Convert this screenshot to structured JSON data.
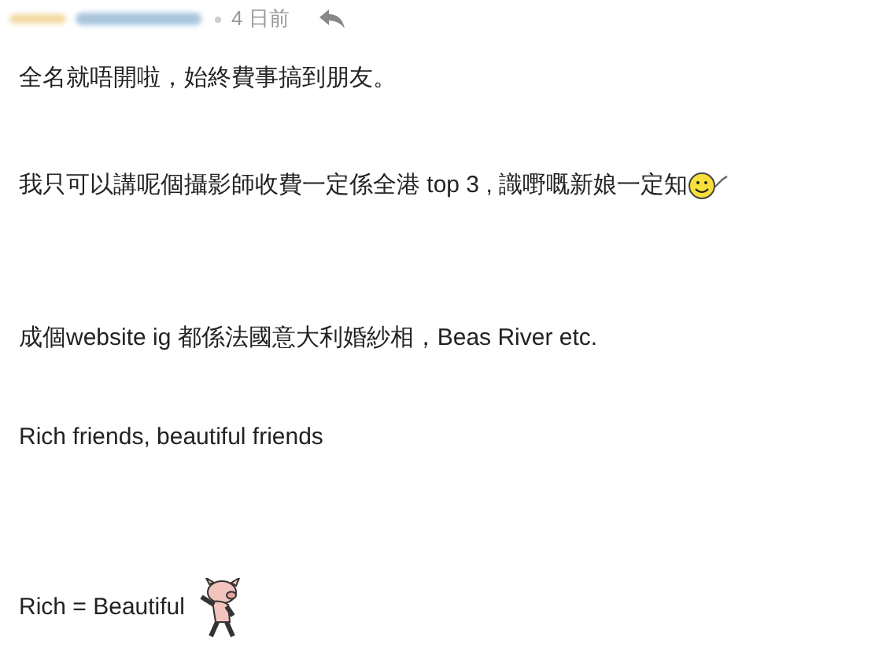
{
  "post": {
    "time": "4 日前",
    "paragraphs": [
      {
        "text": "全名就唔開啦，始終費事搞到朋友。",
        "kind": "plain"
      },
      {
        "text": "我只可以講呢個攝影師收費一定係全港 top 3 , 識嘢嘅新娘一定知",
        "kind": "smiley"
      },
      {
        "text": "成個website ig 都係法國意大利婚紗相，Beas River etc.",
        "kind": "plain"
      },
      {
        "text": "Rich friends, beautiful friends",
        "kind": "plain"
      },
      {
        "text": "Rich = Beautiful",
        "kind": "sticker"
      }
    ]
  }
}
